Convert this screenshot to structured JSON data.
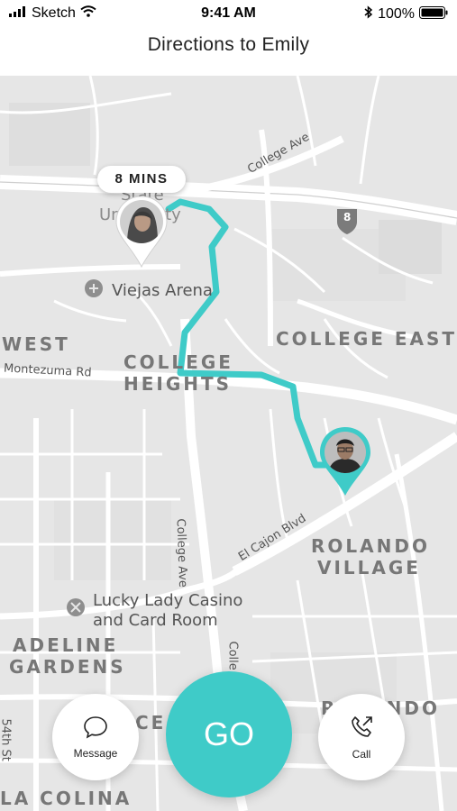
{
  "status_bar": {
    "carrier": "Sketch",
    "time": "9:41 AM",
    "battery": "100%",
    "icons": [
      "signal-bars-icon",
      "wifi-icon",
      "bluetooth-icon",
      "battery-icon"
    ]
  },
  "nav": {
    "title": "Directions to Emily"
  },
  "map": {
    "eta": "8 MINS",
    "area_labels": {
      "west": "WEST",
      "college_heights_1": "COLLEGE",
      "college_heights_2": "HEIGHTS",
      "college_east": "COLLEGE EAST",
      "rolando_village_1": "ROLANDO",
      "rolando_village_2": "VILLAGE",
      "adeline_gardens_1": "ADELINE",
      "adeline_gardens_2": "GARDENS",
      "la_colina": "LA COLINA",
      "rolando_partial": "ROLANDO",
      "cev_partial": "CE"
    },
    "road_labels": {
      "college_ave_top": "College Ave",
      "montezuma": "Montezuma Rd",
      "college_ave_mid": "College Ave",
      "el_cajon": "El Cajon Blvd",
      "fifty_fourth": "54th St",
      "college_partial": "Colle"
    },
    "poi": {
      "state_university_1": "State",
      "state_university_2": "University",
      "viejas_arena": "Viejas Arena",
      "casino_line1": "Lucky Lady Casino",
      "casino_line2": "and Card Room"
    },
    "highway_shield": "8",
    "route_color": "#3fcbc8"
  },
  "actions": {
    "message_label": "Message",
    "go_label": "GO",
    "call_label": "Call",
    "accent": "#3fcbc8"
  }
}
